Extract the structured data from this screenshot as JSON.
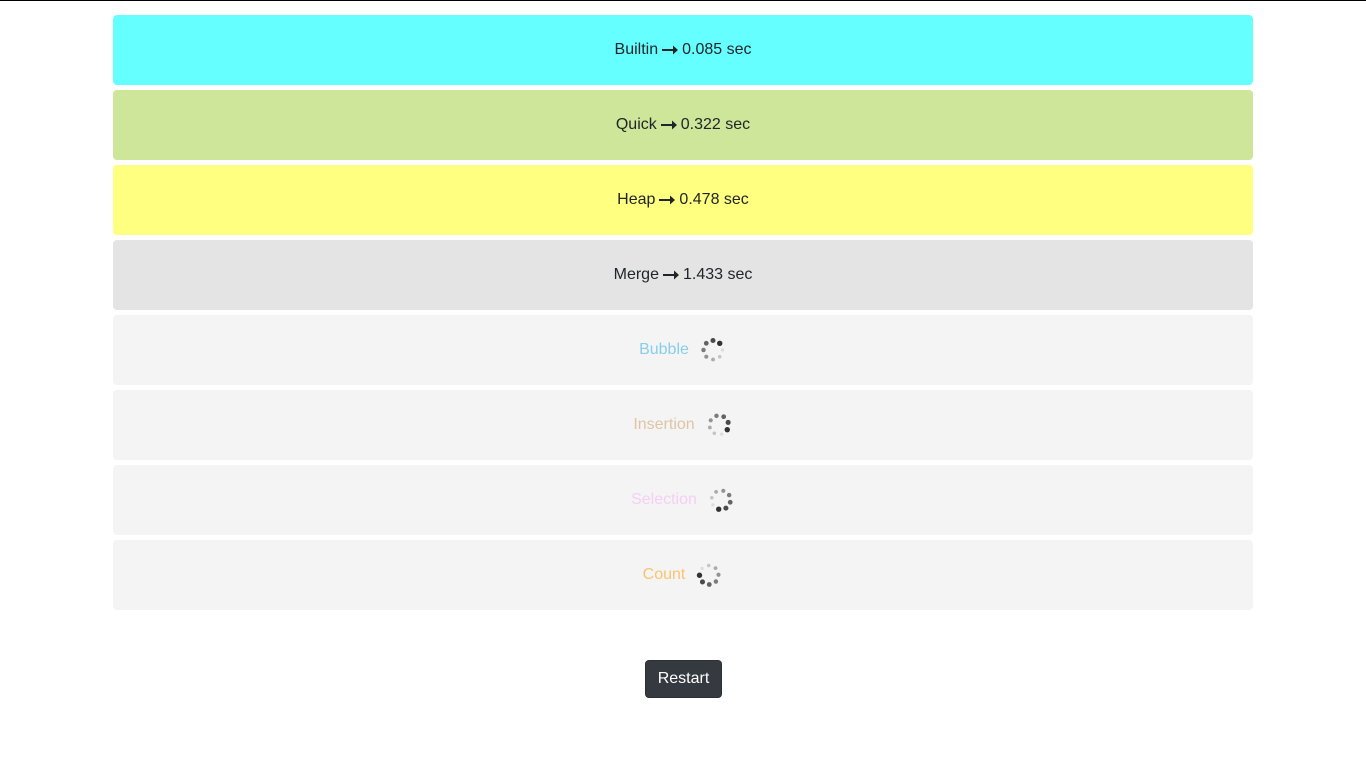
{
  "results": [
    {
      "name": "Builtin",
      "time": "0.085 sec",
      "bg": "#66ffff",
      "status": "done"
    },
    {
      "name": "Quick",
      "time": "0.322 sec",
      "bg": "#cde699",
      "status": "done"
    },
    {
      "name": "Heap",
      "time": "0.478 sec",
      "bg": "#ffff80",
      "status": "done"
    },
    {
      "name": "Merge",
      "time": "1.433 sec",
      "bg": "#e4e4e4",
      "status": "done"
    },
    {
      "name": "Bubble",
      "color": "#87ceeb",
      "bg": "#f4f4f4",
      "status": "running"
    },
    {
      "name": "Insertion",
      "color": "#dec5a5",
      "bg": "#f4f4f4",
      "status": "running"
    },
    {
      "name": "Selection",
      "color": "#f5d0f5",
      "bg": "#f4f4f4",
      "status": "running"
    },
    {
      "name": "Count",
      "color": "#fcc36f",
      "bg": "#f4f4f4",
      "status": "running"
    }
  ],
  "icons": {
    "arrow": "long-arrow-right-icon",
    "spinner": "loading-spinner-icon"
  },
  "restart_label": "Restart"
}
